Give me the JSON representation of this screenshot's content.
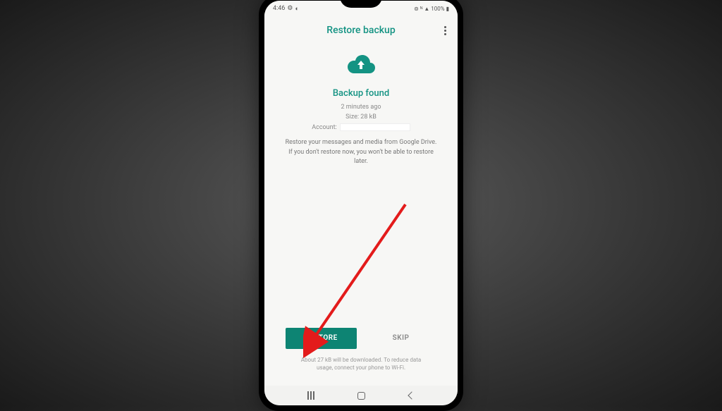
{
  "status": {
    "time": "4:46",
    "battery": "100%"
  },
  "header": {
    "title": "Restore backup"
  },
  "backup": {
    "title": "Backup found",
    "time_ago": "2 minutes ago",
    "size": "Size: 28 kB",
    "account_label": "Account:",
    "description": "Restore your messages and media from Google Drive. If you don't restore now, you won't be able to restore later."
  },
  "buttons": {
    "restore": "RESTORE",
    "skip": "SKIP"
  },
  "footer": {
    "note": "About 27 kB will be downloaded. To reduce data usage, connect your phone to Wi-Fi."
  },
  "colors": {
    "accent": "#149383",
    "button": "#0d8473"
  }
}
